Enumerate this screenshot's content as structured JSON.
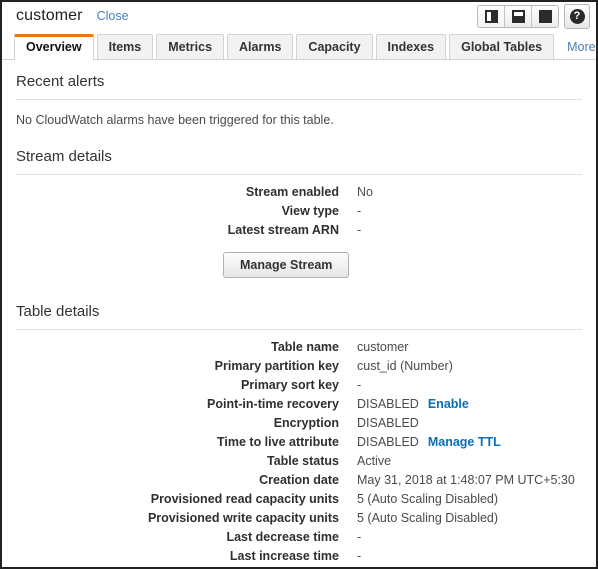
{
  "window": {
    "table_title": "customer",
    "close_label": "Close"
  },
  "titlebar_controls": {
    "layout_buttons": [
      {
        "name": "split-vertical",
        "label": "Split vertical",
        "active": true
      },
      {
        "name": "split-horizontal",
        "label": "Split horizontal",
        "active": false
      },
      {
        "name": "full-screen",
        "label": "Full screen",
        "active": false
      }
    ],
    "help_label": "?"
  },
  "tabs": {
    "items": [
      {
        "label": "Overview",
        "active": true
      },
      {
        "label": "Items",
        "active": false
      },
      {
        "label": "Metrics",
        "active": false
      },
      {
        "label": "Alarms",
        "active": false
      },
      {
        "label": "Capacity",
        "active": false
      },
      {
        "label": "Indexes",
        "active": false
      },
      {
        "label": "Global Tables",
        "active": false
      }
    ],
    "more_label": "More"
  },
  "recent_alerts": {
    "heading": "Recent alerts",
    "message": "No CloudWatch alarms have been triggered for this table."
  },
  "stream_details": {
    "heading": "Stream details",
    "rows": [
      {
        "label": "Stream enabled",
        "value": "No"
      },
      {
        "label": "View type",
        "value": "-"
      },
      {
        "label": "Latest stream ARN",
        "value": "-"
      }
    ],
    "manage_button": "Manage Stream"
  },
  "table_details": {
    "heading": "Table details",
    "rows": [
      {
        "label": "Table name",
        "value": "customer",
        "action": ""
      },
      {
        "label": "Primary partition key",
        "value": "cust_id (Number)",
        "action": ""
      },
      {
        "label": "Primary sort key",
        "value": "-",
        "action": ""
      },
      {
        "label": "Point-in-time recovery",
        "value": "DISABLED",
        "action": "Enable"
      },
      {
        "label": "Encryption",
        "value": "DISABLED",
        "action": ""
      },
      {
        "label": "Time to live attribute",
        "value": "DISABLED",
        "action": "Manage TTL"
      },
      {
        "label": "Table status",
        "value": "Active",
        "action": ""
      },
      {
        "label": "Creation date",
        "value": "May 31, 2018 at 1:48:07 PM UTC+5:30",
        "action": ""
      },
      {
        "label": "Provisioned read capacity units",
        "value": "5 (Auto Scaling Disabled)",
        "action": ""
      },
      {
        "label": "Provisioned write capacity units",
        "value": "5 (Auto Scaling Disabled)",
        "action": ""
      },
      {
        "label": "Last decrease time",
        "value": "-",
        "action": ""
      },
      {
        "label": "Last increase time",
        "value": "-",
        "action": ""
      }
    ]
  },
  "colors": {
    "accent_orange": "#e1781a",
    "link_blue": "#4a7ebb",
    "action_link_blue": "#0a6fb5",
    "text_dark": "#2f2f2f",
    "text_muted": "#4a4a4a",
    "divider": "#e0e0e0"
  }
}
